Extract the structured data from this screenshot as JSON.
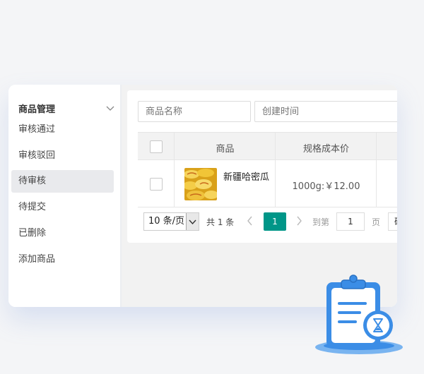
{
  "sidebar": {
    "title": "商品管理",
    "items": [
      {
        "label": "审核通过"
      },
      {
        "label": "审核驳回"
      },
      {
        "label": "待审核"
      },
      {
        "label": "待提交"
      },
      {
        "label": "已删除"
      },
      {
        "label": "添加商品"
      }
    ],
    "active_index": 2
  },
  "filters": {
    "name_placeholder": "商品名称",
    "date_placeholder": "创建时间"
  },
  "table": {
    "columns": [
      "",
      "商品",
      "规格成本价"
    ],
    "rows": [
      {
        "product_name": "新疆哈密瓜",
        "spec_price": "1000g:￥12.00",
        "image": "melon-slices-photo"
      }
    ]
  },
  "pagination": {
    "page_size": "10 条/页",
    "total": "共 1 条",
    "current_page": "1",
    "goto_prefix": "到第",
    "goto_value": "1",
    "goto_suffix": "页",
    "confirm_label": "确定"
  },
  "colors": {
    "accent": "#009688",
    "illustration_blue": "#3b8de6"
  },
  "icons": [
    "chevron-down-icon",
    "chevron-left-icon",
    "chevron-right-icon",
    "clipboard-hourglass-icon"
  ]
}
